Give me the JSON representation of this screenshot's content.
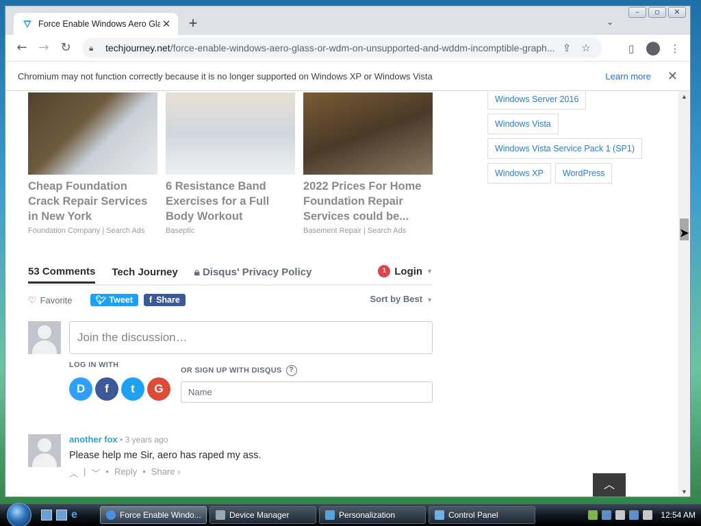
{
  "browser": {
    "tab_title": "Force Enable Windows Aero Glass",
    "url_domain": "techjourney.net",
    "url_path": "/force-enable-windows-aero-glass-or-wdm-on-unsupported-and-wddm-incomptible-graph...",
    "infobar_text": "Chromium may not function correctly because it is no longer supported on Windows XP or Windows Vista",
    "infobar_link": "Learn more"
  },
  "ads": [
    {
      "title": "Cheap Foundation Crack Repair Services in New York",
      "source": "Foundation Company | Search Ads"
    },
    {
      "title": "6 Resistance Band Exercises for a Full Body Workout",
      "source": "Baseptic"
    },
    {
      "title": "2022 Prices For Home Foundation Repair Services could be...",
      "source": "Basement Repair | Search Ads"
    }
  ],
  "tags": [
    "Windows Server 2016",
    "Windows Vista",
    "Windows Vista Service Pack 1 (SP1)",
    "Windows XP",
    "WordPress"
  ],
  "disqus": {
    "tab_comments": "53 Comments",
    "tab_site": "Tech Journey",
    "tab_privacy": "Disqus' Privacy Policy",
    "login_badge": "1",
    "login": "Login",
    "favorite": "Favorite",
    "tweet": "Tweet",
    "share": "Share",
    "sort": "Sort by Best",
    "compose_placeholder": "Join the discussion…",
    "log_in_with": "LOG IN WITH",
    "sign_up": "OR SIGN UP WITH DISQUS",
    "name_placeholder": "Name"
  },
  "comment": {
    "author": "another fox",
    "time": "3 years ago",
    "text": "Please help me Sir, aero has raped my ass.",
    "reply": "Reply",
    "share": "Share ›"
  },
  "taskbar": {
    "tasks": [
      "Force Enable Windo...",
      "Device Manager",
      "Personalization",
      "Control Panel"
    ],
    "clock": "12:54 AM"
  },
  "colors": {
    "link": "#1a73e8",
    "disqus_blue": "#2e9fd8",
    "badge": "#e0424a"
  }
}
